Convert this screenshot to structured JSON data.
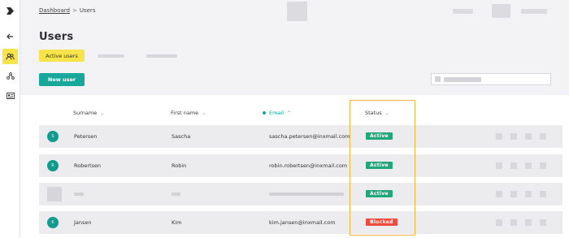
{
  "breadcrumb": {
    "root": "Dashboard",
    "separator": ">",
    "current": "Users"
  },
  "page": {
    "title": "Users"
  },
  "tabs": {
    "active_label": "Active users"
  },
  "toolbar": {
    "new_user_label": "New user"
  },
  "table": {
    "columns": {
      "surname": "Surname",
      "first_name": "First name",
      "email": "Email",
      "status": "Status"
    },
    "rows": [
      {
        "initial": "S",
        "surname": "Petersen",
        "first_name": "Sascha",
        "email": "sascha.petersen@inxmail.com",
        "status": "Active"
      },
      {
        "initial": "R",
        "surname": "Robertsen",
        "first_name": "Robin",
        "email": "robin.robertsen@inxmail.com",
        "status": "Active"
      },
      {
        "status": "Active"
      },
      {
        "initial": "K",
        "surname": "Jansen",
        "first_name": "Kim",
        "email": "kim.jansen@inxmail.com",
        "status": "Blocked"
      }
    ]
  },
  "icons": {
    "logo": "logo-icon",
    "back": "arrow-left-icon",
    "users": "users-icon",
    "network": "network-icon",
    "card": "id-card-icon",
    "sort_desc": "chevron-down-icon",
    "sort_asc": "chevron-up-icon"
  },
  "colors": {
    "accent_yellow": "#f7e34a",
    "primary_teal": "#18a79b",
    "status_active": "#22a77a",
    "status_blocked": "#ee4b3f",
    "highlight": "#f0b33c"
  }
}
